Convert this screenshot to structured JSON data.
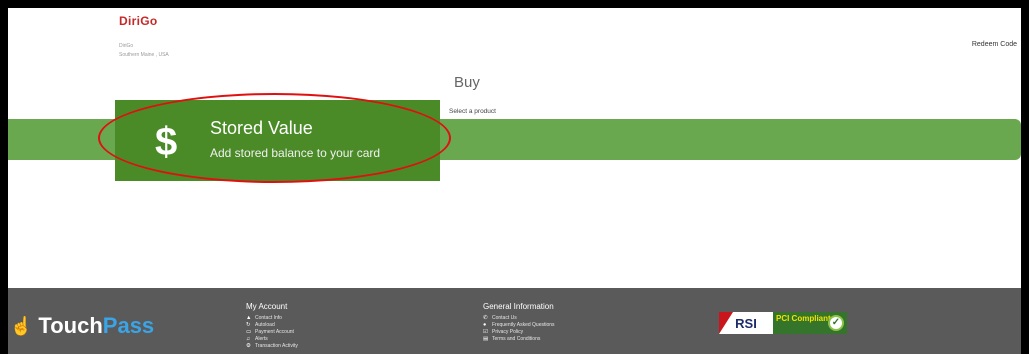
{
  "header": {
    "logo_text": "DiriGo",
    "company_name": "DiriGo",
    "company_location": "Southern Maine , USA",
    "redeem_label": "Redeem Code"
  },
  "main": {
    "title": "Buy",
    "select_label": "Select a product",
    "product": {
      "icon": "dollar-icon",
      "icon_glyph": "$",
      "title": "Stored Value",
      "subtitle": "Add stored balance to your card"
    }
  },
  "footer": {
    "brand": {
      "part1": "Touch",
      "part2": "Pass",
      "icon": "hand-pointer-icon"
    },
    "my_account": {
      "heading": "My Account",
      "items": [
        {
          "icon": "user-icon",
          "glyph": "▲",
          "label": "Contact Info"
        },
        {
          "icon": "refresh-icon",
          "glyph": "↻",
          "label": "Autoload"
        },
        {
          "icon": "credit-card-icon",
          "glyph": "▭",
          "label": "Payment Account"
        },
        {
          "icon": "bell-icon",
          "glyph": "♫",
          "label": "Alerts"
        },
        {
          "icon": "gear-icon",
          "glyph": "⚙",
          "label": "Transaction Activity"
        }
      ]
    },
    "general_info": {
      "heading": "General Information",
      "items": [
        {
          "icon": "phone-icon",
          "glyph": "✆",
          "label": "Contact Us"
        },
        {
          "icon": "question-icon",
          "glyph": "●",
          "label": "Frequently Asked Questions"
        },
        {
          "icon": "check-square-icon",
          "glyph": "☑",
          "label": "Privacy Policy"
        },
        {
          "icon": "document-icon",
          "glyph": "▤",
          "label": "Terms and Conditions"
        }
      ]
    },
    "badge": {
      "rsi": "RSI",
      "pci": "PCI Compliant",
      "check_icon": "check-circle-icon"
    }
  },
  "colors": {
    "brand_red": "#c62828",
    "product_green": "#4a8b28",
    "bar_green": "#6aa84f",
    "footer_gray": "#5a5a5a",
    "touchpass_blue": "#3ba4e6",
    "annotation_red": "#e01010"
  }
}
